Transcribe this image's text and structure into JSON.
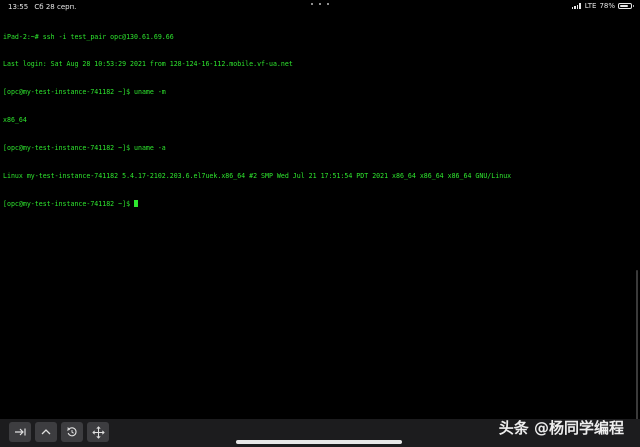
{
  "status_bar": {
    "time": "13:55",
    "date": "Сб 28 серп.",
    "network": "LTE",
    "battery_percent": "78%",
    "battery_level": 0.78
  },
  "terminal": {
    "lines": [
      "iPad-2:~# ssh -i test_pair opc@130.61.69.66",
      "Last login: Sat Aug 28 10:53:29 2021 from 128-124-16-112.mobile.vf-ua.net",
      "[opc@my-test-instance-741182 ~]$ uname -m",
      "x86_64",
      "[opc@my-test-instance-741182 ~]$ uname -a",
      "Linux my-test-instance-741182 5.4.17-2102.203.6.el7uek.x86_64 #2 SMP Wed Jul 21 17:51:54 PDT 2021 x86_64 x86_64 x86_64 GNU/Linux"
    ],
    "prompt": "[opc@my-test-instance-741182 ~]$ "
  },
  "toolbar": {
    "buttons": [
      {
        "name": "tab-key-button",
        "icon": "tab-arrow-icon"
      },
      {
        "name": "control-key-button",
        "icon": "caret-up-icon"
      },
      {
        "name": "history-button",
        "icon": "history-icon"
      },
      {
        "name": "move-cursor-button",
        "icon": "move-arrows-icon"
      }
    ]
  },
  "watermark": "头条 @杨同学编程",
  "colors": {
    "terminal_text": "#2ee62e",
    "background": "#000000",
    "toolbar_bg": "#1c1c1e",
    "button_bg": "#3d3d40"
  }
}
